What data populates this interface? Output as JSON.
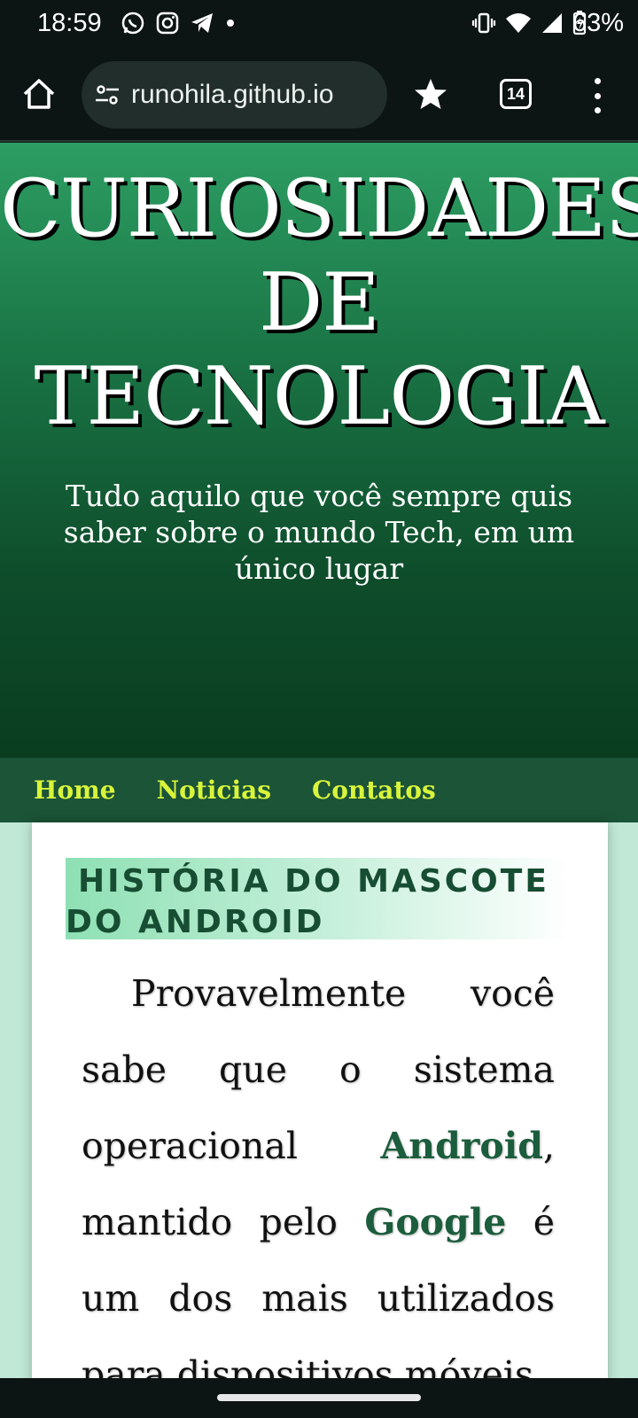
{
  "status_bar": {
    "time": "18:59",
    "battery": "63%",
    "icons_left": [
      "whatsapp-icon",
      "instagram-icon",
      "telegram-icon",
      "dot-icon"
    ],
    "icons_right": [
      "vibrate-icon",
      "wifi-icon",
      "signal-icon",
      "battery-charging-icon"
    ]
  },
  "browser": {
    "url": "runohila.github.io",
    "tab_count": "14"
  },
  "hero": {
    "title_line1": "CURIOSIDADES",
    "title_line2": "DE",
    "title_line3": "TECNOLOGIA",
    "subtitle": "Tudo aquilo que você sempre quis saber sobre o mundo Tech, em um único lugar"
  },
  "nav": {
    "items": [
      "Home",
      "Noticias",
      "Contatos"
    ]
  },
  "article": {
    "heading": "História do mascote do Android",
    "body_part1": "Provavelmente você sabe que o sistema operacional ",
    "highlight1": "Android",
    "body_part2": ", mantido pelo ",
    "highlight2": "Google",
    "body_part3": " é um dos mais utilizados para dispositivos móveis"
  },
  "colors": {
    "nav_link": "#d8f53a",
    "highlight": "#1b5d3c",
    "page_bg": "#c1e8d6"
  }
}
